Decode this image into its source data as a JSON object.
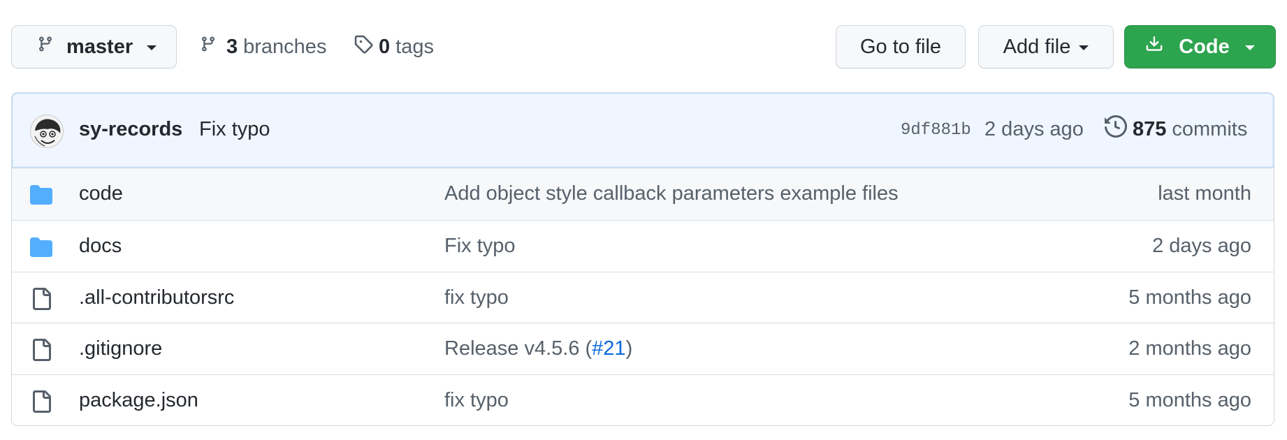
{
  "toolbar": {
    "branch_label": "master",
    "branches_count": "3",
    "branches_label": "branches",
    "tags_count": "0",
    "tags_label": "tags",
    "goto_file_label": "Go to file",
    "add_file_label": "Add file",
    "code_label": "Code"
  },
  "latest_commit": {
    "author": "sy-records",
    "message": "Fix typo",
    "sha": "9df881b",
    "time": "2 days ago",
    "commit_count": "875",
    "commits_label": "commits"
  },
  "files": [
    {
      "type": "folder",
      "icon": "folder-icon",
      "name": "code",
      "message": "Add object style callback parameters example files",
      "age": "last month"
    },
    {
      "type": "folder",
      "icon": "folder-icon",
      "name": "docs",
      "message": "Fix typo",
      "age": "2 days ago"
    },
    {
      "type": "file",
      "icon": "file-icon",
      "name": ".all-contributorsrc",
      "message": "fix typo",
      "age": "5 months ago"
    },
    {
      "type": "file",
      "icon": "file-icon",
      "name": ".gitignore",
      "message_prefix": "Release v4.5.6 (",
      "message_link": "#21",
      "message_suffix": ")",
      "age": "2 months ago"
    },
    {
      "type": "file",
      "icon": "file-icon",
      "name": "package.json",
      "message": "fix typo",
      "age": "5 months ago"
    }
  ],
  "colors": {
    "code_button": "#2da44e",
    "folder_icon": "#54aeff",
    "link": "#0969da",
    "commit_bg": "#f0f6ff"
  }
}
